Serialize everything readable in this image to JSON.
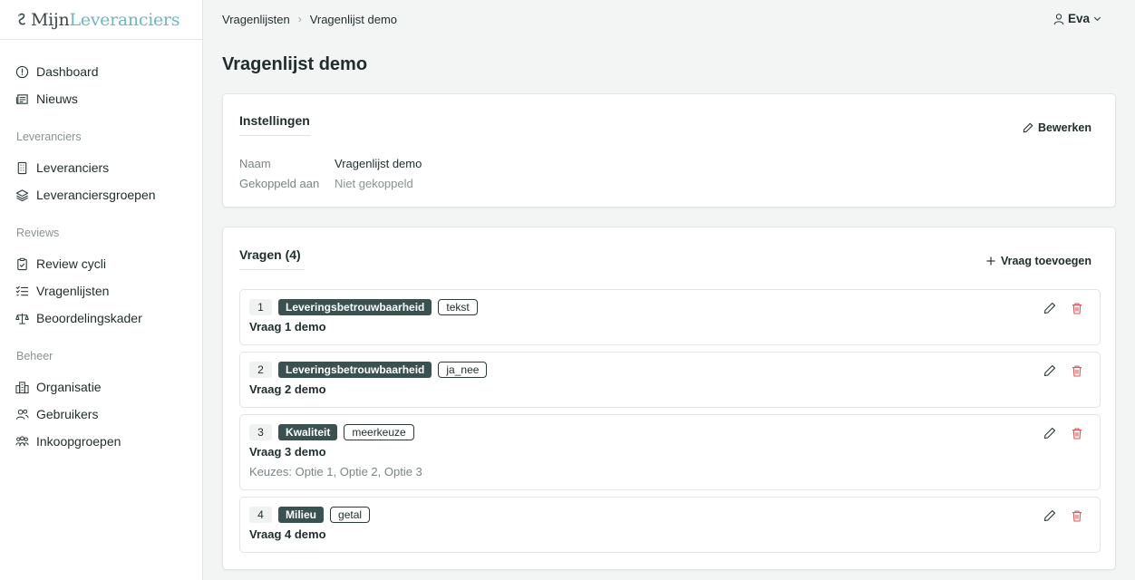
{
  "app": {
    "logo_part1": "Mijn",
    "logo_part2": "Leveranciers"
  },
  "sidebar": {
    "top_items": [
      {
        "label": "Dashboard",
        "icon": "dashboard-icon"
      },
      {
        "label": "Nieuws",
        "icon": "newspaper-icon"
      }
    ],
    "sections": [
      {
        "title": "Leveranciers",
        "items": [
          {
            "label": "Leveranciers",
            "icon": "building-icon"
          },
          {
            "label": "Leveranciersgroepen",
            "icon": "layers-icon"
          }
        ]
      },
      {
        "title": "Reviews",
        "items": [
          {
            "label": "Review cycli",
            "icon": "clipboard-check-icon"
          },
          {
            "label": "Vragenlijsten",
            "icon": "checklist-icon"
          },
          {
            "label": "Beoordelingskader",
            "icon": "scale-icon"
          }
        ]
      },
      {
        "title": "Beheer",
        "items": [
          {
            "label": "Organisatie",
            "icon": "organization-icon"
          },
          {
            "label": "Gebruikers",
            "icon": "users-icon"
          },
          {
            "label": "Inkoopgroepen",
            "icon": "group-icon"
          }
        ]
      }
    ]
  },
  "header": {
    "breadcrumb": [
      "Vragenlijsten",
      "Vragenlijst demo"
    ],
    "separator": "›",
    "user_name": "Eva"
  },
  "page": {
    "title": "Vragenlijst demo"
  },
  "settings": {
    "title": "Instellingen",
    "edit_label": "Bewerken",
    "fields": [
      {
        "key": "Naam",
        "value": "Vragenlijst demo"
      },
      {
        "key": "Gekoppeld aan",
        "value": "Niet gekoppeld"
      }
    ]
  },
  "questions": {
    "title": "Vragen (4)",
    "add_label": "Vraag toevoegen",
    "items": [
      {
        "number": "1",
        "category": "Leveringsbetrouwbaarheid",
        "type": "tekst",
        "text": "Vraag 1 demo",
        "extra": ""
      },
      {
        "number": "2",
        "category": "Leveringsbetrouwbaarheid",
        "type": "ja_nee",
        "text": "Vraag 2 demo",
        "extra": ""
      },
      {
        "number": "3",
        "category": "Kwaliteit",
        "type": "meerkeuze",
        "text": "Vraag 3 demo",
        "extra": "Keuzes: Optie 1, Optie 2, Optie 3"
      },
      {
        "number": "4",
        "category": "Milieu",
        "type": "getal",
        "text": "Vraag 4 demo",
        "extra": ""
      }
    ]
  },
  "colors": {
    "accent": "#6fb5c2",
    "badge": "#3a5152",
    "delete": "#e05252"
  }
}
